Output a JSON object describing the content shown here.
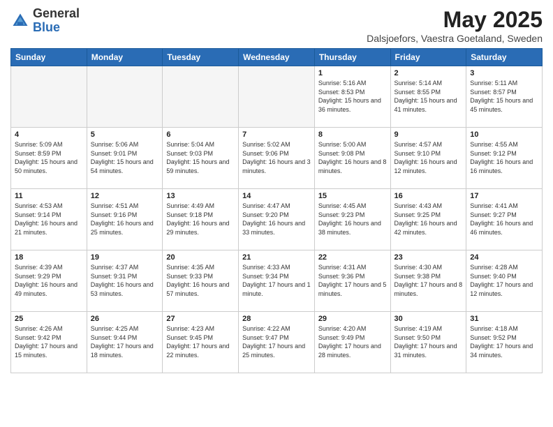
{
  "header": {
    "logo_general": "General",
    "logo_blue": "Blue",
    "title": "May 2025",
    "subtitle": "Dalsjoefors, Vaestra Goetaland, Sweden"
  },
  "days_of_week": [
    "Sunday",
    "Monday",
    "Tuesday",
    "Wednesday",
    "Thursday",
    "Friday",
    "Saturday"
  ],
  "weeks": [
    [
      {
        "day": "",
        "detail": ""
      },
      {
        "day": "",
        "detail": ""
      },
      {
        "day": "",
        "detail": ""
      },
      {
        "day": "",
        "detail": ""
      },
      {
        "day": "1",
        "detail": "Sunrise: 5:16 AM\nSunset: 8:53 PM\nDaylight: 15 hours and 36 minutes."
      },
      {
        "day": "2",
        "detail": "Sunrise: 5:14 AM\nSunset: 8:55 PM\nDaylight: 15 hours and 41 minutes."
      },
      {
        "day": "3",
        "detail": "Sunrise: 5:11 AM\nSunset: 8:57 PM\nDaylight: 15 hours and 45 minutes."
      }
    ],
    [
      {
        "day": "4",
        "detail": "Sunrise: 5:09 AM\nSunset: 8:59 PM\nDaylight: 15 hours and 50 minutes."
      },
      {
        "day": "5",
        "detail": "Sunrise: 5:06 AM\nSunset: 9:01 PM\nDaylight: 15 hours and 54 minutes."
      },
      {
        "day": "6",
        "detail": "Sunrise: 5:04 AM\nSunset: 9:03 PM\nDaylight: 15 hours and 59 minutes."
      },
      {
        "day": "7",
        "detail": "Sunrise: 5:02 AM\nSunset: 9:06 PM\nDaylight: 16 hours and 3 minutes."
      },
      {
        "day": "8",
        "detail": "Sunrise: 5:00 AM\nSunset: 9:08 PM\nDaylight: 16 hours and 8 minutes."
      },
      {
        "day": "9",
        "detail": "Sunrise: 4:57 AM\nSunset: 9:10 PM\nDaylight: 16 hours and 12 minutes."
      },
      {
        "day": "10",
        "detail": "Sunrise: 4:55 AM\nSunset: 9:12 PM\nDaylight: 16 hours and 16 minutes."
      }
    ],
    [
      {
        "day": "11",
        "detail": "Sunrise: 4:53 AM\nSunset: 9:14 PM\nDaylight: 16 hours and 21 minutes."
      },
      {
        "day": "12",
        "detail": "Sunrise: 4:51 AM\nSunset: 9:16 PM\nDaylight: 16 hours and 25 minutes."
      },
      {
        "day": "13",
        "detail": "Sunrise: 4:49 AM\nSunset: 9:18 PM\nDaylight: 16 hours and 29 minutes."
      },
      {
        "day": "14",
        "detail": "Sunrise: 4:47 AM\nSunset: 9:20 PM\nDaylight: 16 hours and 33 minutes."
      },
      {
        "day": "15",
        "detail": "Sunrise: 4:45 AM\nSunset: 9:23 PM\nDaylight: 16 hours and 38 minutes."
      },
      {
        "day": "16",
        "detail": "Sunrise: 4:43 AM\nSunset: 9:25 PM\nDaylight: 16 hours and 42 minutes."
      },
      {
        "day": "17",
        "detail": "Sunrise: 4:41 AM\nSunset: 9:27 PM\nDaylight: 16 hours and 46 minutes."
      }
    ],
    [
      {
        "day": "18",
        "detail": "Sunrise: 4:39 AM\nSunset: 9:29 PM\nDaylight: 16 hours and 49 minutes."
      },
      {
        "day": "19",
        "detail": "Sunrise: 4:37 AM\nSunset: 9:31 PM\nDaylight: 16 hours and 53 minutes."
      },
      {
        "day": "20",
        "detail": "Sunrise: 4:35 AM\nSunset: 9:33 PM\nDaylight: 16 hours and 57 minutes."
      },
      {
        "day": "21",
        "detail": "Sunrise: 4:33 AM\nSunset: 9:34 PM\nDaylight: 17 hours and 1 minute."
      },
      {
        "day": "22",
        "detail": "Sunrise: 4:31 AM\nSunset: 9:36 PM\nDaylight: 17 hours and 5 minutes."
      },
      {
        "day": "23",
        "detail": "Sunrise: 4:30 AM\nSunset: 9:38 PM\nDaylight: 17 hours and 8 minutes."
      },
      {
        "day": "24",
        "detail": "Sunrise: 4:28 AM\nSunset: 9:40 PM\nDaylight: 17 hours and 12 minutes."
      }
    ],
    [
      {
        "day": "25",
        "detail": "Sunrise: 4:26 AM\nSunset: 9:42 PM\nDaylight: 17 hours and 15 minutes."
      },
      {
        "day": "26",
        "detail": "Sunrise: 4:25 AM\nSunset: 9:44 PM\nDaylight: 17 hours and 18 minutes."
      },
      {
        "day": "27",
        "detail": "Sunrise: 4:23 AM\nSunset: 9:45 PM\nDaylight: 17 hours and 22 minutes."
      },
      {
        "day": "28",
        "detail": "Sunrise: 4:22 AM\nSunset: 9:47 PM\nDaylight: 17 hours and 25 minutes."
      },
      {
        "day": "29",
        "detail": "Sunrise: 4:20 AM\nSunset: 9:49 PM\nDaylight: 17 hours and 28 minutes."
      },
      {
        "day": "30",
        "detail": "Sunrise: 4:19 AM\nSunset: 9:50 PM\nDaylight: 17 hours and 31 minutes."
      },
      {
        "day": "31",
        "detail": "Sunrise: 4:18 AM\nSunset: 9:52 PM\nDaylight: 17 hours and 34 minutes."
      }
    ]
  ]
}
